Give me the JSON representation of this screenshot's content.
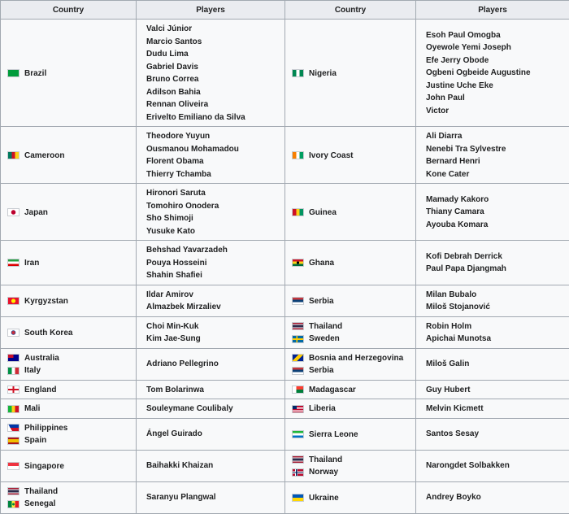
{
  "headers": [
    "Country",
    "Players",
    "Country",
    "Players"
  ],
  "rows": [
    {
      "left_countries": [
        {
          "name": "Brazil",
          "flag": "br"
        }
      ],
      "left_players": [
        "Valci Júnior",
        "Marcio Santos",
        "Dudu Lima",
        "Gabriel Davis",
        "Bruno Correa",
        "Adilson Bahia",
        "Rennan Oliveira",
        "Erivelto Emiliano da Silva"
      ],
      "right_countries": [
        {
          "name": "Nigeria",
          "flag": "ng"
        }
      ],
      "right_players": [
        "Esoh Paul Omogba",
        "Oyewole Yemi Joseph",
        "Efe Jerry Obode",
        "Ogbeni Ogbeide Augustine",
        "Justine Uche Eke",
        "John Paul",
        "Victor"
      ]
    },
    {
      "left_countries": [
        {
          "name": "Cameroon",
          "flag": "cm"
        }
      ],
      "left_players": [
        "Theodore Yuyun",
        "Ousmanou Mohamadou",
        "Florent Obama",
        "Thierry Tchamba"
      ],
      "right_countries": [
        {
          "name": "Ivory Coast",
          "flag": "ci"
        }
      ],
      "right_players": [
        "Ali Diarra",
        "Nenebi Tra Sylvestre",
        "Bernard Henri",
        "Kone Cater"
      ]
    },
    {
      "left_countries": [
        {
          "name": "Japan",
          "flag": "jp"
        }
      ],
      "left_players": [
        "Hironori Saruta",
        "Tomohiro Onodera",
        "Sho Shimoji",
        "Yusuke Kato"
      ],
      "right_countries": [
        {
          "name": "Guinea",
          "flag": "gn"
        }
      ],
      "right_players": [
        "Mamady Kakoro",
        "Thiany Camara",
        "Ayouba Komara"
      ]
    },
    {
      "left_countries": [
        {
          "name": "Iran",
          "flag": "ir"
        }
      ],
      "left_players": [
        "Behshad Yavarzadeh",
        "Pouya Hosseini",
        "Shahin Shafiei"
      ],
      "right_countries": [
        {
          "name": "Ghana",
          "flag": "gh"
        }
      ],
      "right_players": [
        "Kofi Debrah Derrick",
        "Paul Papa Djangmah"
      ]
    },
    {
      "left_countries": [
        {
          "name": "Kyrgyzstan",
          "flag": "kg"
        }
      ],
      "left_players": [
        "Ildar Amirov",
        "Almazbek Mirzaliev"
      ],
      "right_countries": [
        {
          "name": "Serbia",
          "flag": "rs"
        }
      ],
      "right_players": [
        "Milan Bubalo",
        "Miloš Stojanović"
      ]
    },
    {
      "left_countries": [
        {
          "name": "South Korea",
          "flag": "kr"
        }
      ],
      "left_players": [
        "Choi Min-Kuk",
        "Kim Jae-Sung"
      ],
      "right_countries": [
        {
          "name": "Thailand",
          "flag": "th"
        },
        {
          "name": "Sweden",
          "flag": "se"
        }
      ],
      "right_players": [
        "Robin Holm",
        "Apichai Munotsa"
      ]
    },
    {
      "left_countries": [
        {
          "name": "Australia",
          "flag": "au"
        },
        {
          "name": "Italy",
          "flag": "it"
        }
      ],
      "left_players": [
        "Adriano Pellegrino"
      ],
      "right_countries": [
        {
          "name": "Bosnia and Herzegovina",
          "flag": "ba"
        },
        {
          "name": "Serbia",
          "flag": "rs"
        }
      ],
      "right_players": [
        "Miloš Galin"
      ]
    },
    {
      "left_countries": [
        {
          "name": "England",
          "flag": "en"
        }
      ],
      "left_players": [
        "Tom Bolarinwa"
      ],
      "right_countries": [
        {
          "name": "Madagascar",
          "flag": "mg"
        }
      ],
      "right_players": [
        "Guy Hubert"
      ]
    },
    {
      "left_countries": [
        {
          "name": "Mali",
          "flag": "ml"
        }
      ],
      "left_players": [
        "Souleymane Coulibaly"
      ],
      "right_countries": [
        {
          "name": "Liberia",
          "flag": "lr"
        }
      ],
      "right_players": [
        "Melvin Kicmett"
      ]
    },
    {
      "left_countries": [
        {
          "name": "Philippines",
          "flag": "ph"
        },
        {
          "name": "Spain",
          "flag": "es"
        }
      ],
      "left_players": [
        "Ángel Guirado"
      ],
      "right_countries": [
        {
          "name": "Sierra Leone",
          "flag": "sl"
        }
      ],
      "right_players": [
        "Santos Sesay"
      ]
    },
    {
      "left_countries": [
        {
          "name": "Singapore",
          "flag": "sg"
        }
      ],
      "left_players": [
        "Baihakki Khaizan"
      ],
      "right_countries": [
        {
          "name": "Thailand",
          "flag": "th"
        },
        {
          "name": "Norway",
          "flag": "no"
        }
      ],
      "right_players": [
        "Narongdet Solbakken"
      ]
    },
    {
      "left_countries": [
        {
          "name": "Thailand",
          "flag": "th"
        },
        {
          "name": "Senegal",
          "flag": "sn"
        }
      ],
      "left_players": [
        "Saranyu Plangwal"
      ],
      "right_countries": [
        {
          "name": "Ukraine",
          "flag": "ua"
        }
      ],
      "right_players": [
        "Andrey Boyko"
      ]
    }
  ]
}
